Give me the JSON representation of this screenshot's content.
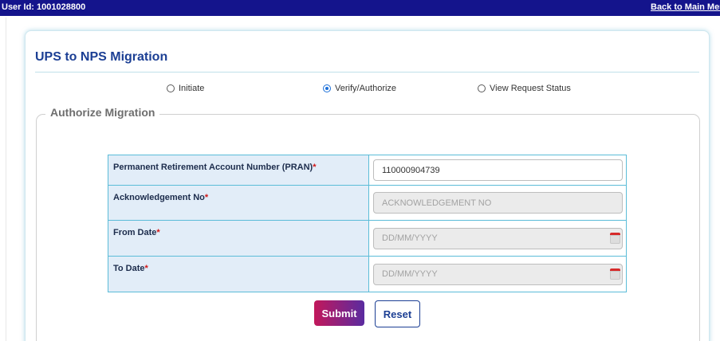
{
  "topbar": {
    "user_id": "User Id: 1001028800",
    "back_link": "Back to Main Menu"
  },
  "page": {
    "title": "UPS to NPS Migration"
  },
  "modes": {
    "options": [
      "Initiate",
      "Verify/Authorize",
      "View Request Status"
    ],
    "selected": "Verify/Authorize"
  },
  "section": {
    "legend": "Authorize Migration"
  },
  "form": {
    "required_mark": "*",
    "pran": {
      "label": "Permanent Retirement Account Number (PRAN)",
      "value": "110000904739"
    },
    "ack": {
      "label": "Acknowledgement No",
      "placeholder": "ACKNOWLEDGEMENT NO"
    },
    "from_date": {
      "label": "From Date",
      "placeholder": "DD/MM/YYYY"
    },
    "to_date": {
      "label": "To Date",
      "placeholder": "DD/MM/YYYY"
    }
  },
  "buttons": {
    "submit": "Submit",
    "reset": "Reset"
  },
  "icons": {
    "radio": "radio-icon",
    "calendar": "calendar-icon"
  },
  "colors": {
    "topbar": "#14148c",
    "title": "#1c3f94",
    "table_border": "#5bbcd8",
    "label_bg": "#e2edf8",
    "required": "#d01818",
    "submit_from": "#c2185b",
    "submit_to": "#5a2ba0"
  }
}
